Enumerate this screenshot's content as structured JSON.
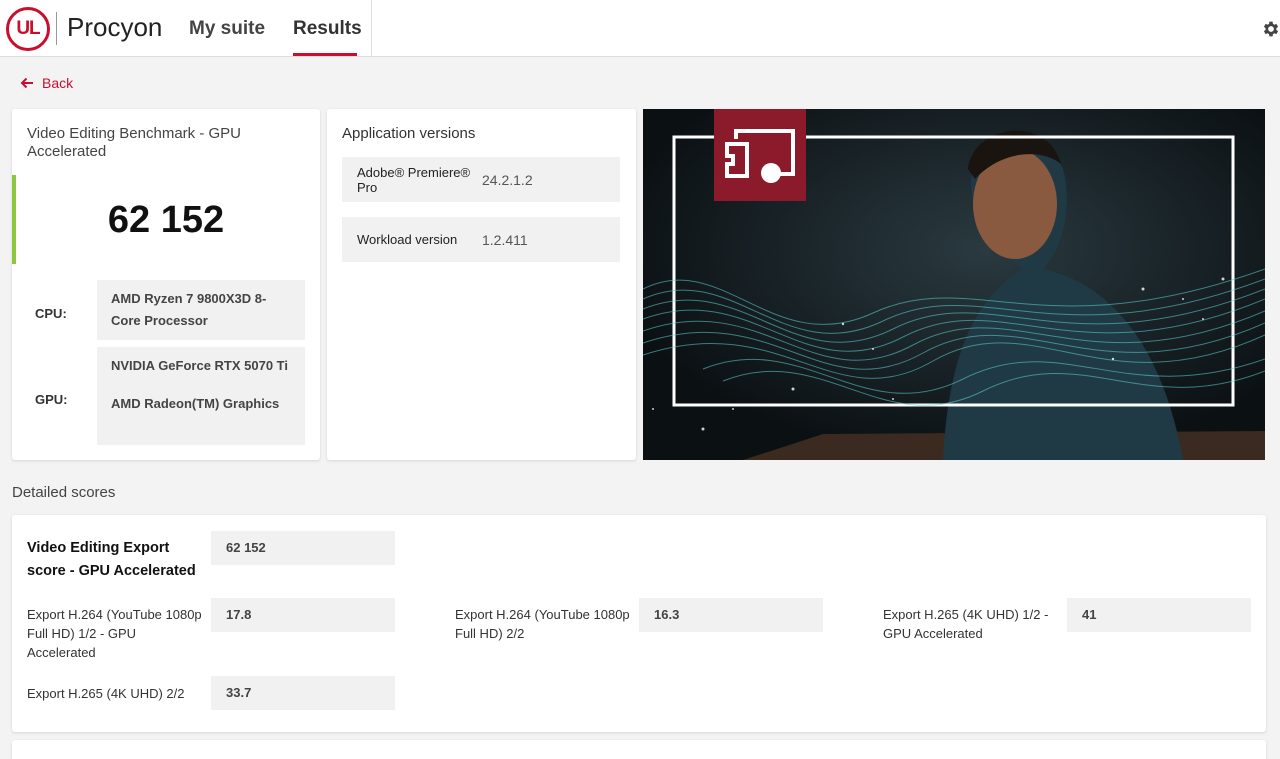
{
  "header": {
    "logo_text": "UL",
    "brand": "Procyon",
    "nav": [
      {
        "label": "My suite"
      },
      {
        "label": "Results"
      }
    ]
  },
  "back_label": "Back",
  "result": {
    "title": "Video Editing Benchmark - GPU Accelerated",
    "score": "62 152",
    "cpu_label": "CPU:",
    "cpu_value": "AMD Ryzen 7 9800X3D 8-Core Processor",
    "gpu_label": "GPU:",
    "gpu_values": [
      "NVIDIA GeForce RTX 5070 Ti",
      "AMD Radeon(TM) Graphics"
    ]
  },
  "versions": {
    "title": "Application versions",
    "rows": [
      {
        "key": "Adobe® Premiere® Pro",
        "value": "24.2.1.2"
      },
      {
        "key": "Workload version",
        "value": "1.2.411"
      }
    ]
  },
  "detailed": {
    "title": "Detailed scores",
    "main": {
      "name": "Video Editing Export score - GPU Accelerated",
      "value": "62 152"
    },
    "items": [
      {
        "name": "Export H.264 (YouTube 1080p Full HD) 1/2 - GPU Accelerated",
        "value": "17.8"
      },
      {
        "name": "Export H.264 (YouTube 1080p Full HD) 2/2",
        "value": "16.3"
      },
      {
        "name": "Export H.265 (4K UHD) 1/2 - GPU Accelerated",
        "value": "41"
      },
      {
        "name": "Export H.265 (4K UHD) 2/2",
        "value": "33.7"
      }
    ]
  },
  "colors": {
    "accent": "#c8102e",
    "score_bar": "#8dc63f",
    "hero_badge": "#8b1a2b",
    "hero_wave": "#5fd3d0"
  },
  "icons": {
    "back": "arrow-left-icon",
    "settings": "gear-icon",
    "hero_badge": "screen-share-icon"
  }
}
